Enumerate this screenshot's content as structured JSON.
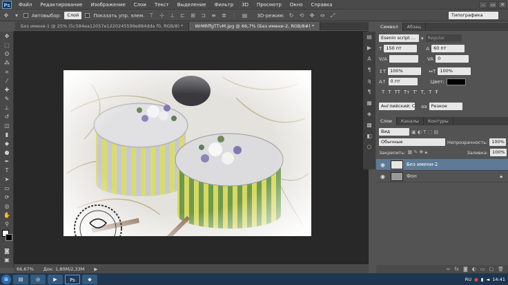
{
  "app": {
    "logo": "Ps"
  },
  "menu": [
    "Файл",
    "Редактирование",
    "Изображение",
    "Слои",
    "Текст",
    "Выделение",
    "Фильтр",
    "3D",
    "Просмотр",
    "Окно",
    "Справка"
  ],
  "window_controls": [
    "–",
    "▭",
    "✕"
  ],
  "options": {
    "autoselect_label": "Автовыбор:",
    "autoselect_value": "Слой",
    "show_controls_label": "Показать упр. элем.",
    "mode3d_label": "3D-режим:",
    "workspace": "Типографика"
  },
  "tabs": [
    {
      "label": "Без имени-1 @ 25% (5c584ea12057e1220245599e884dda f0, RGB/8) *",
      "active": false
    },
    {
      "label": "WrMRffgTTvM.jpg @ 66,7% (Без имени-2, RGB/8#) *",
      "active": true
    }
  ],
  "status": {
    "zoom": "66,67%",
    "doc": "Док: 1,80M/2,33M"
  },
  "char_panel": {
    "tabs": [
      "Символ",
      "Абзац"
    ],
    "font_family": "Esenin script ...",
    "font_style": "Regular",
    "size": "150 пт",
    "leading": "60 пт",
    "kerning": "",
    "tracking": "0",
    "vscale": "100%",
    "hscale": "100%",
    "baseline": "0 пт",
    "color_label": "Цвет:",
    "language": "Английский: США",
    "aa_label": "aa",
    "antialias": "Резкое",
    "typo_buttons": [
      "T",
      "T",
      "TT",
      "Tт",
      "T'",
      "T,",
      "T",
      "Ŧ"
    ]
  },
  "layers_panel": {
    "tabs": [
      "Слои",
      "Каналы",
      "Контуры"
    ],
    "filter": "Вид",
    "blend": "Обычные",
    "opacity_label": "Непрозрачность:",
    "opacity": "100%",
    "lock_label": "Закрепить:",
    "fill_label": "Заливка:",
    "fill": "100%",
    "layers": [
      {
        "name": "Без имени-2",
        "selected": true
      },
      {
        "name": "Фон",
        "selected": false
      }
    ]
  },
  "taskbar": {
    "lang": "RU",
    "time": "14:41"
  }
}
